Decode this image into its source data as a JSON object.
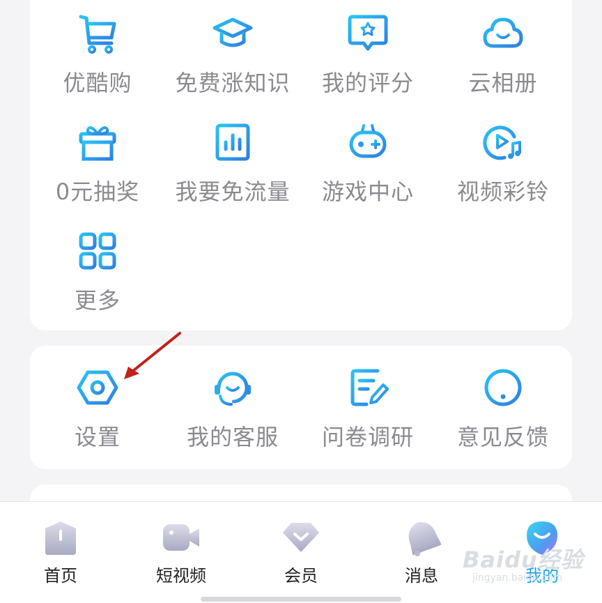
{
  "services": [
    {
      "label": "优酷购",
      "icon": "shopping-cart-icon"
    },
    {
      "label": "免费涨知识",
      "icon": "graduation-cap-icon"
    },
    {
      "label": "我的评分",
      "icon": "star-comment-icon"
    },
    {
      "label": "云相册",
      "icon": "cloud-icon"
    },
    {
      "label": "0元抽奖",
      "icon": "gift-box-icon"
    },
    {
      "label": "我要免流量",
      "icon": "bar-chart-icon"
    },
    {
      "label": "游戏中心",
      "icon": "gamepad-icon"
    },
    {
      "label": "视频彩铃",
      "icon": "music-play-icon"
    },
    {
      "label": "更多",
      "icon": "grid-more-icon"
    }
  ],
  "tools": [
    {
      "label": "设置",
      "icon": "settings-hexagon-icon"
    },
    {
      "label": "我的客服",
      "icon": "headset-icon"
    },
    {
      "label": "问卷调研",
      "icon": "survey-edit-icon"
    },
    {
      "label": "意见反馈",
      "icon": "exclamation-circle-icon"
    }
  ],
  "tabbar": [
    {
      "label": "首页",
      "icon": "home-icon",
      "active": false
    },
    {
      "label": "短视频",
      "icon": "video-camera-icon",
      "active": false
    },
    {
      "label": "会员",
      "icon": "vip-diamond-icon",
      "active": false
    },
    {
      "label": "消息",
      "icon": "bell-icon",
      "active": false
    },
    {
      "label": "我的",
      "icon": "profile-icon",
      "active": true
    }
  ],
  "watermark": {
    "line1": "Baidu经验",
    "line2": "jingyan.baidu.com"
  },
  "colors": {
    "accent": "#1fa4e6",
    "label_gray": "#8a8a90",
    "arrow": "#c0211b"
  }
}
